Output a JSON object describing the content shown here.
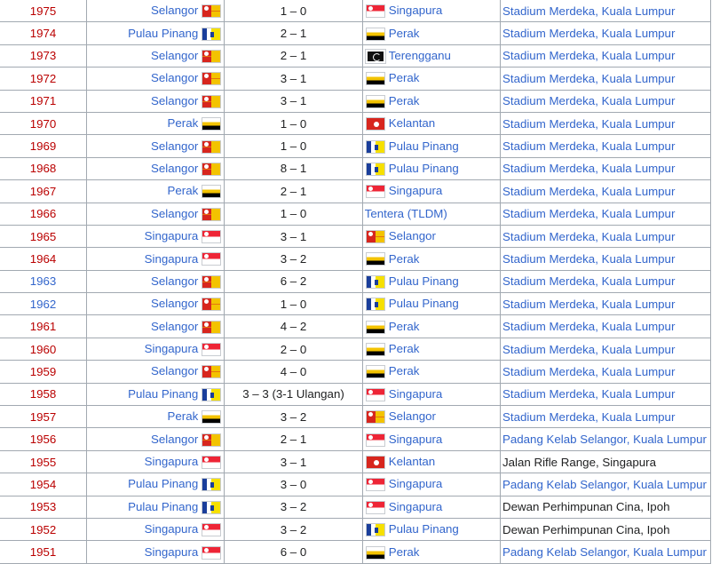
{
  "rows": [
    {
      "year": "1975",
      "year_color": "red",
      "winner": "Selangor",
      "winner_flag": "selangor",
      "score": "1 – 0",
      "runner": "Singapura",
      "runner_flag": "singapura",
      "venue": "Stadium Merdeka, Kuala Lumpur",
      "venue_link": true
    },
    {
      "year": "1974",
      "year_color": "red",
      "winner": "Pulau Pinang",
      "winner_flag": "penang",
      "score": "2 – 1",
      "runner": "Perak",
      "runner_flag": "perak",
      "venue": "Stadium Merdeka, Kuala Lumpur",
      "venue_link": true
    },
    {
      "year": "1973",
      "year_color": "red",
      "winner": "Selangor",
      "winner_flag": "selangor",
      "score": "2 – 1",
      "runner": "Terengganu",
      "runner_flag": "terengganu",
      "venue": "Stadium Merdeka, Kuala Lumpur",
      "venue_link": true
    },
    {
      "year": "1972",
      "year_color": "red",
      "winner": "Selangor",
      "winner_flag": "selangor",
      "score": "3 – 1",
      "runner": "Perak",
      "runner_flag": "perak",
      "venue": "Stadium Merdeka, Kuala Lumpur",
      "venue_link": true
    },
    {
      "year": "1971",
      "year_color": "red",
      "winner": "Selangor",
      "winner_flag": "selangor",
      "score": "3 – 1",
      "runner": "Perak",
      "runner_flag": "perak",
      "venue": "Stadium Merdeka, Kuala Lumpur",
      "venue_link": true
    },
    {
      "year": "1970",
      "year_color": "red",
      "winner": "Perak",
      "winner_flag": "perak",
      "score": "1 – 0",
      "runner": "Kelantan",
      "runner_flag": "kelantan",
      "venue": "Stadium Merdeka, Kuala Lumpur",
      "venue_link": true
    },
    {
      "year": "1969",
      "year_color": "red",
      "winner": "Selangor",
      "winner_flag": "selangor",
      "score": "1 – 0",
      "runner": "Pulau Pinang",
      "runner_flag": "penang",
      "venue": "Stadium Merdeka, Kuala Lumpur",
      "venue_link": true
    },
    {
      "year": "1968",
      "year_color": "red",
      "winner": "Selangor",
      "winner_flag": "selangor",
      "score": "8 – 1",
      "runner": "Pulau Pinang",
      "runner_flag": "penang",
      "venue": "Stadium Merdeka, Kuala Lumpur",
      "venue_link": true
    },
    {
      "year": "1967",
      "year_color": "red",
      "winner": "Perak",
      "winner_flag": "perak",
      "score": "2 – 1",
      "runner": "Singapura",
      "runner_flag": "singapura",
      "venue": "Stadium Merdeka, Kuala Lumpur",
      "venue_link": true
    },
    {
      "year": "1966",
      "year_color": "red",
      "winner": "Selangor",
      "winner_flag": "selangor",
      "score": "1 – 0",
      "runner": "Tentera (TLDM)",
      "runner_flag": "",
      "venue": "Stadium Merdeka, Kuala Lumpur",
      "venue_link": true
    },
    {
      "year": "1965",
      "year_color": "red",
      "winner": "Singapura",
      "winner_flag": "singapura",
      "score": "3 – 1",
      "runner": "Selangor",
      "runner_flag": "selangor",
      "venue": "Stadium Merdeka, Kuala Lumpur",
      "venue_link": true
    },
    {
      "year": "1964",
      "year_color": "red",
      "winner": "Singapura",
      "winner_flag": "singapura",
      "score": "3 – 2",
      "runner": "Perak",
      "runner_flag": "perak",
      "venue": "Stadium Merdeka, Kuala Lumpur",
      "venue_link": true
    },
    {
      "year": "1963",
      "year_color": "blue",
      "winner": "Selangor",
      "winner_flag": "selangor",
      "score": "6 – 2",
      "runner": "Pulau Pinang",
      "runner_flag": "penang",
      "venue": "Stadium Merdeka, Kuala Lumpur",
      "venue_link": true
    },
    {
      "year": "1962",
      "year_color": "blue",
      "winner": "Selangor",
      "winner_flag": "selangor",
      "score": "1 – 0",
      "runner": "Pulau Pinang",
      "runner_flag": "penang",
      "venue": "Stadium Merdeka, Kuala Lumpur",
      "venue_link": true
    },
    {
      "year": "1961",
      "year_color": "red",
      "winner": "Selangor",
      "winner_flag": "selangor",
      "score": "4 – 2",
      "runner": "Perak",
      "runner_flag": "perak",
      "venue": "Stadium Merdeka, Kuala Lumpur",
      "venue_link": true
    },
    {
      "year": "1960",
      "year_color": "red",
      "winner": "Singapura",
      "winner_flag": "singapura",
      "score": "2 – 0",
      "runner": "Perak",
      "runner_flag": "perak",
      "venue": "Stadium Merdeka, Kuala Lumpur",
      "venue_link": true
    },
    {
      "year": "1959",
      "year_color": "red",
      "winner": "Selangor",
      "winner_flag": "selangor",
      "score": "4 – 0",
      "runner": "Perak",
      "runner_flag": "perak",
      "venue": "Stadium Merdeka, Kuala Lumpur",
      "venue_link": true
    },
    {
      "year": "1958",
      "year_color": "red",
      "winner": "Pulau Pinang",
      "winner_flag": "penang",
      "score": "3 – 3 (3-1 Ulangan)",
      "runner": "Singapura",
      "runner_flag": "singapura",
      "venue": "Stadium Merdeka, Kuala Lumpur",
      "venue_link": true
    },
    {
      "year": "1957",
      "year_color": "red",
      "winner": "Perak",
      "winner_flag": "perak",
      "score": "3 – 2",
      "runner": "Selangor",
      "runner_flag": "selangor",
      "venue": "Stadium Merdeka, Kuala Lumpur",
      "venue_link": true
    },
    {
      "year": "1956",
      "year_color": "red",
      "winner": "Selangor",
      "winner_flag": "selangor",
      "score": "2 – 1",
      "runner": "Singapura",
      "runner_flag": "singapura",
      "venue": "Padang Kelab Selangor, Kuala Lumpur",
      "venue_link": true
    },
    {
      "year": "1955",
      "year_color": "red",
      "winner": "Singapura",
      "winner_flag": "singapura",
      "score": "3 – 1",
      "runner": "Kelantan",
      "runner_flag": "kelantan",
      "venue": "Jalan Rifle Range, Singapura",
      "venue_link": false
    },
    {
      "year": "1954",
      "year_color": "red",
      "winner": "Pulau Pinang",
      "winner_flag": "penang",
      "score": "3 – 0",
      "runner": "Singapura",
      "runner_flag": "singapura",
      "venue": "Padang Kelab Selangor, Kuala Lumpur",
      "venue_link": true
    },
    {
      "year": "1953",
      "year_color": "red",
      "winner": "Pulau Pinang",
      "winner_flag": "penang",
      "score": "3 – 2",
      "runner": "Singapura",
      "runner_flag": "singapura",
      "venue": "Dewan Perhimpunan Cina, Ipoh",
      "venue_link": false
    },
    {
      "year": "1952",
      "year_color": "red",
      "winner": "Singapura",
      "winner_flag": "singapura",
      "score": "3 – 2",
      "runner": "Pulau Pinang",
      "runner_flag": "penang",
      "venue": "Dewan Perhimpunan Cina, Ipoh",
      "venue_link": false
    },
    {
      "year": "1951",
      "year_color": "red",
      "winner": "Singapura",
      "winner_flag": "singapura",
      "score": "6 – 0",
      "runner": "Perak",
      "runner_flag": "perak",
      "venue": "Padang Kelab Selangor, Kuala Lumpur",
      "venue_link": true
    }
  ]
}
